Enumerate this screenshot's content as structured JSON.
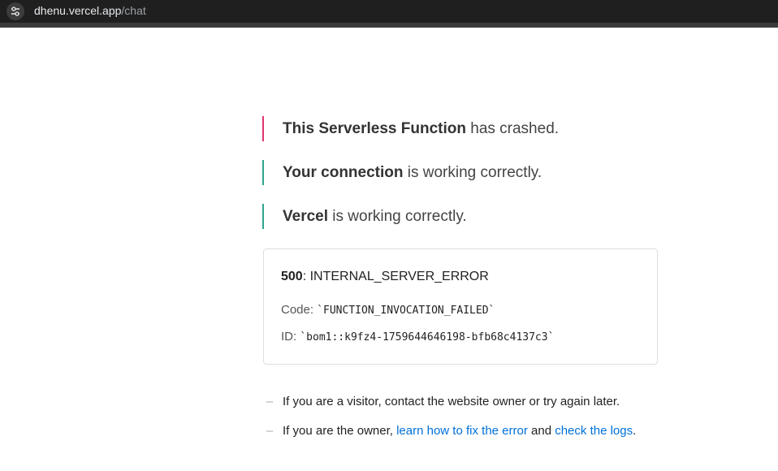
{
  "browser": {
    "url_host": "dhenu.vercel.app",
    "url_path": "/chat",
    "site_info_icon": "tune-icon"
  },
  "status": {
    "function": {
      "bold": "This Serverless Function",
      "rest": " has crashed.",
      "color": "#e0336c"
    },
    "connection": {
      "bold": "Your connection",
      "rest": " is working correctly.",
      "color": "#2fa58a"
    },
    "vercel": {
      "bold": "Vercel",
      "rest": " is working correctly.",
      "color": "#2fa58a"
    }
  },
  "error": {
    "status_code": "500",
    "status_name": ": INTERNAL_SERVER_ERROR",
    "code_label": "Code: ",
    "code_value": "`FUNCTION_INVOCATION_FAILED`",
    "id_label": "ID: ",
    "id_value": "`bom1::k9fz4-1759644646198-bfb68c4137c3`"
  },
  "help": {
    "dash": "–",
    "visitor_text": "If you are a visitor, contact the website owner or try again later.",
    "owner_text": "If you are the owner, ",
    "fix_link": "learn how to fix the error",
    "and_text": " and ",
    "logs_link": "check the logs",
    "end_text": "."
  },
  "colors": {
    "crash_accent": "#e0336c",
    "ok_accent": "#2fa58a",
    "link": "#0070d9"
  }
}
